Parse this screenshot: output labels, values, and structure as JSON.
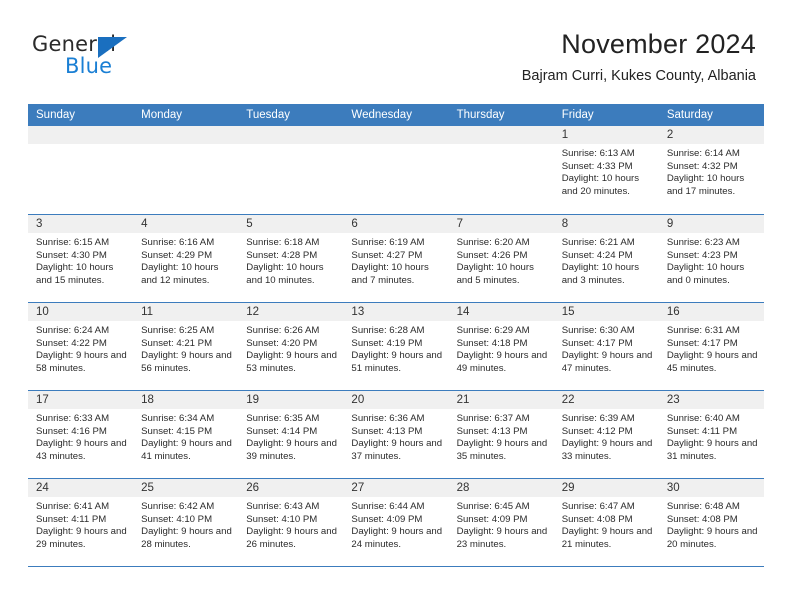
{
  "branding": {
    "logo_text_1": "General",
    "logo_text_2": "Blue",
    "accent_color": "#1a7fd4",
    "header_blue": "#3c7cbd"
  },
  "header": {
    "title": "November 2024",
    "subtitle": "Bajram Curri, Kukes County, Albania"
  },
  "calendar": {
    "day_headers": [
      "Sunday",
      "Monday",
      "Tuesday",
      "Wednesday",
      "Thursday",
      "Friday",
      "Saturday"
    ],
    "weeks": [
      [
        {
          "day": "",
          "empty": true
        },
        {
          "day": "",
          "empty": true
        },
        {
          "day": "",
          "empty": true
        },
        {
          "day": "",
          "empty": true
        },
        {
          "day": "",
          "empty": true
        },
        {
          "day": "1",
          "sunrise": "Sunrise: 6:13 AM",
          "sunset": "Sunset: 4:33 PM",
          "daylight": "Daylight: 10 hours and 20 minutes."
        },
        {
          "day": "2",
          "sunrise": "Sunrise: 6:14 AM",
          "sunset": "Sunset: 4:32 PM",
          "daylight": "Daylight: 10 hours and 17 minutes."
        }
      ],
      [
        {
          "day": "3",
          "sunrise": "Sunrise: 6:15 AM",
          "sunset": "Sunset: 4:30 PM",
          "daylight": "Daylight: 10 hours and 15 minutes."
        },
        {
          "day": "4",
          "sunrise": "Sunrise: 6:16 AM",
          "sunset": "Sunset: 4:29 PM",
          "daylight": "Daylight: 10 hours and 12 minutes."
        },
        {
          "day": "5",
          "sunrise": "Sunrise: 6:18 AM",
          "sunset": "Sunset: 4:28 PM",
          "daylight": "Daylight: 10 hours and 10 minutes."
        },
        {
          "day": "6",
          "sunrise": "Sunrise: 6:19 AM",
          "sunset": "Sunset: 4:27 PM",
          "daylight": "Daylight: 10 hours and 7 minutes."
        },
        {
          "day": "7",
          "sunrise": "Sunrise: 6:20 AM",
          "sunset": "Sunset: 4:26 PM",
          "daylight": "Daylight: 10 hours and 5 minutes."
        },
        {
          "day": "8",
          "sunrise": "Sunrise: 6:21 AM",
          "sunset": "Sunset: 4:24 PM",
          "daylight": "Daylight: 10 hours and 3 minutes."
        },
        {
          "day": "9",
          "sunrise": "Sunrise: 6:23 AM",
          "sunset": "Sunset: 4:23 PM",
          "daylight": "Daylight: 10 hours and 0 minutes."
        }
      ],
      [
        {
          "day": "10",
          "sunrise": "Sunrise: 6:24 AM",
          "sunset": "Sunset: 4:22 PM",
          "daylight": "Daylight: 9 hours and 58 minutes."
        },
        {
          "day": "11",
          "sunrise": "Sunrise: 6:25 AM",
          "sunset": "Sunset: 4:21 PM",
          "daylight": "Daylight: 9 hours and 56 minutes."
        },
        {
          "day": "12",
          "sunrise": "Sunrise: 6:26 AM",
          "sunset": "Sunset: 4:20 PM",
          "daylight": "Daylight: 9 hours and 53 minutes."
        },
        {
          "day": "13",
          "sunrise": "Sunrise: 6:28 AM",
          "sunset": "Sunset: 4:19 PM",
          "daylight": "Daylight: 9 hours and 51 minutes."
        },
        {
          "day": "14",
          "sunrise": "Sunrise: 6:29 AM",
          "sunset": "Sunset: 4:18 PM",
          "daylight": "Daylight: 9 hours and 49 minutes."
        },
        {
          "day": "15",
          "sunrise": "Sunrise: 6:30 AM",
          "sunset": "Sunset: 4:17 PM",
          "daylight": "Daylight: 9 hours and 47 minutes."
        },
        {
          "day": "16",
          "sunrise": "Sunrise: 6:31 AM",
          "sunset": "Sunset: 4:17 PM",
          "daylight": "Daylight: 9 hours and 45 minutes."
        }
      ],
      [
        {
          "day": "17",
          "sunrise": "Sunrise: 6:33 AM",
          "sunset": "Sunset: 4:16 PM",
          "daylight": "Daylight: 9 hours and 43 minutes."
        },
        {
          "day": "18",
          "sunrise": "Sunrise: 6:34 AM",
          "sunset": "Sunset: 4:15 PM",
          "daylight": "Daylight: 9 hours and 41 minutes."
        },
        {
          "day": "19",
          "sunrise": "Sunrise: 6:35 AM",
          "sunset": "Sunset: 4:14 PM",
          "daylight": "Daylight: 9 hours and 39 minutes."
        },
        {
          "day": "20",
          "sunrise": "Sunrise: 6:36 AM",
          "sunset": "Sunset: 4:13 PM",
          "daylight": "Daylight: 9 hours and 37 minutes."
        },
        {
          "day": "21",
          "sunrise": "Sunrise: 6:37 AM",
          "sunset": "Sunset: 4:13 PM",
          "daylight": "Daylight: 9 hours and 35 minutes."
        },
        {
          "day": "22",
          "sunrise": "Sunrise: 6:39 AM",
          "sunset": "Sunset: 4:12 PM",
          "daylight": "Daylight: 9 hours and 33 minutes."
        },
        {
          "day": "23",
          "sunrise": "Sunrise: 6:40 AM",
          "sunset": "Sunset: 4:11 PM",
          "daylight": "Daylight: 9 hours and 31 minutes."
        }
      ],
      [
        {
          "day": "24",
          "sunrise": "Sunrise: 6:41 AM",
          "sunset": "Sunset: 4:11 PM",
          "daylight": "Daylight: 9 hours and 29 minutes."
        },
        {
          "day": "25",
          "sunrise": "Sunrise: 6:42 AM",
          "sunset": "Sunset: 4:10 PM",
          "daylight": "Daylight: 9 hours and 28 minutes."
        },
        {
          "day": "26",
          "sunrise": "Sunrise: 6:43 AM",
          "sunset": "Sunset: 4:10 PM",
          "daylight": "Daylight: 9 hours and 26 minutes."
        },
        {
          "day": "27",
          "sunrise": "Sunrise: 6:44 AM",
          "sunset": "Sunset: 4:09 PM",
          "daylight": "Daylight: 9 hours and 24 minutes."
        },
        {
          "day": "28",
          "sunrise": "Sunrise: 6:45 AM",
          "sunset": "Sunset: 4:09 PM",
          "daylight": "Daylight: 9 hours and 23 minutes."
        },
        {
          "day": "29",
          "sunrise": "Sunrise: 6:47 AM",
          "sunset": "Sunset: 4:08 PM",
          "daylight": "Daylight: 9 hours and 21 minutes."
        },
        {
          "day": "30",
          "sunrise": "Sunrise: 6:48 AM",
          "sunset": "Sunset: 4:08 PM",
          "daylight": "Daylight: 9 hours and 20 minutes."
        }
      ]
    ]
  }
}
